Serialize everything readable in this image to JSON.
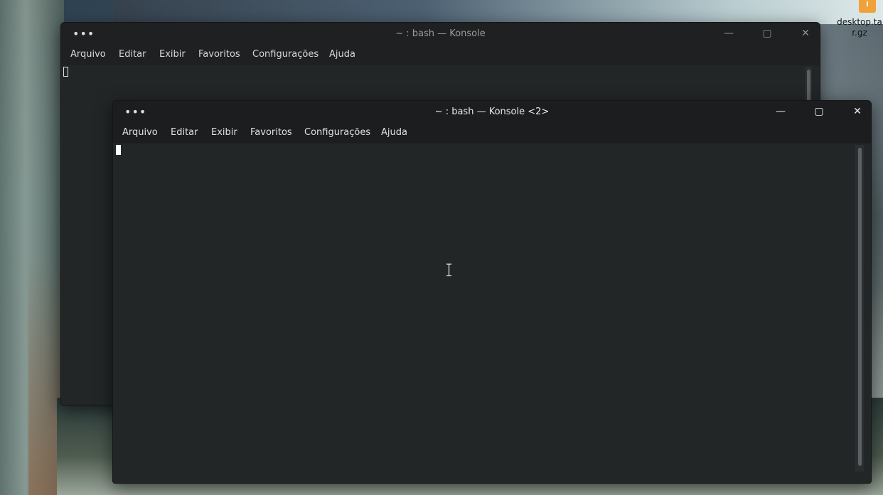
{
  "desktop": {
    "icon_label": "desktop.tar.gz",
    "icon_name": "archive-file-icon"
  },
  "back_window": {
    "title": "~ : bash — Konsole",
    "menu": [
      "Arquivo",
      "Editar",
      "Exibir",
      "Favoritos",
      "Configurações",
      "Ajuda"
    ],
    "menu_button_icon": "hamburger-dots-icon",
    "controls": {
      "minimize": "—",
      "maximize": "▢",
      "close": "✕"
    }
  },
  "front_window": {
    "title": "~ : bash — Konsole <2>",
    "menu": [
      "Arquivo",
      "Editar",
      "Exibir",
      "Favoritos",
      "Configurações",
      "Ajuda"
    ],
    "menu_button_icon": "hamburger-dots-icon",
    "controls": {
      "minimize": "—",
      "maximize": "▢",
      "close": "✕"
    }
  },
  "colors": {
    "terminal_bg": "#232627",
    "titlebar_bg": "#1b1d1e",
    "text": "#e0e1e2",
    "cursor": "#ffffff"
  }
}
